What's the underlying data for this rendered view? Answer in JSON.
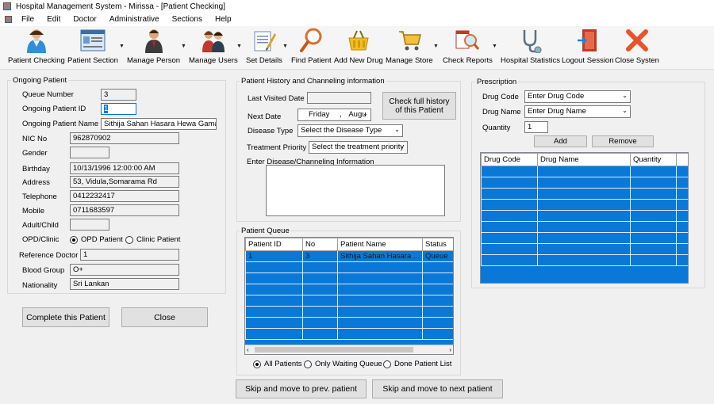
{
  "window": {
    "title": "Hospital Management System - Mirissa - [Patient Checking]"
  },
  "menu": [
    "File",
    "Edit",
    "Doctor",
    "Administrative",
    "Sections",
    "Help"
  ],
  "toolbar": {
    "patient_checking": "Patient Checking",
    "patient_section": "Patient Section",
    "manage_person": "Manage Person",
    "manage_users": "Manage Users",
    "set_details": "Set Details",
    "find_patient": "Find Patient",
    "add_new_drug": "Add New Drug",
    "manage_store": "Manage Store",
    "check_reports": "Check Reports",
    "hospital_statistics": "Hospital Statistics",
    "logout_session": "Logout Session",
    "close_system": "Close Systen"
  },
  "ongoing": {
    "title": "Ongoing Patient",
    "queue_number_label": "Queue Number",
    "queue_number": "3",
    "patient_id_label": "Ongoing Patient ID",
    "patient_id": "1",
    "patient_name_label": "Ongoing Patient Name",
    "patient_name": "Sithija Sahan Hasara Hewa Gamag",
    "nic_label": "NIC No",
    "nic": "962870902",
    "gender_label": "Gender",
    "gender": "",
    "birthday_label": "Birthday",
    "birthday": "10/13/1996 12:00:00 AM",
    "address_label": "Address",
    "address": "53, Vidula,Somarama Rd",
    "telephone_label": "Telephone",
    "telephone": "0412232417",
    "mobile_label": "Mobile",
    "mobile": "0711683597",
    "adult_label": "Adult/Child",
    "adult": "",
    "opd_label": "OPD/Clinic",
    "opd_option": "OPD Patient",
    "clinic_option": "Clinic Patient",
    "ref_doctor_label": "Reference Doctor",
    "ref_doctor": "1",
    "blood_label": "Blood Group",
    "blood": "O+",
    "nationality_label": "Nationality",
    "nationality": "Sri Lankan",
    "complete_btn": "Complete this Patient",
    "close_btn": "Close"
  },
  "history": {
    "title": "Patient History and Channeling information",
    "last_visited_label": "Last Visited Date",
    "last_visited": "",
    "check_history_btn": "Check full history of this Patient",
    "next_date_label": "Next Date",
    "next_date_day": "Friday",
    "next_date_sep": ",",
    "next_date_month": "Augu",
    "disease_type_label": "Disease Type",
    "disease_type": "Select the Disease Type",
    "priority_label": "Treatment Priority",
    "priority": "Select the treatment priority",
    "info_label": "Enter Disease/Channeling Information"
  },
  "queue": {
    "title": "Patient Queue",
    "columns": [
      "Patient ID",
      "No",
      "Patient Name",
      "Status"
    ],
    "rows": [
      [
        "1",
        "3",
        "Sithija Sahan Hasara ...",
        "Queue"
      ]
    ],
    "filter_all": "All Patients",
    "filter_waiting": "Only Waiting Queue",
    "filter_done": "Done Patient List",
    "prev_btn": "Skip and move to prev. patient",
    "next_btn": "Skip and move to next patient"
  },
  "prescription": {
    "title": "Prescription",
    "drug_code_label": "Drug Code",
    "drug_code": "Enter Drug Code",
    "drug_name_label": "Drug Name",
    "drug_name": "Enter Drug Name",
    "quantity_label": "Quantity",
    "quantity": "1",
    "add_btn": "Add",
    "remove_btn": "Remove",
    "columns": [
      "Drug Code",
      "Drug Name",
      "Quantity"
    ]
  },
  "colors": {
    "grid_bg": "#0a78d7",
    "accent": "#0078d7"
  }
}
